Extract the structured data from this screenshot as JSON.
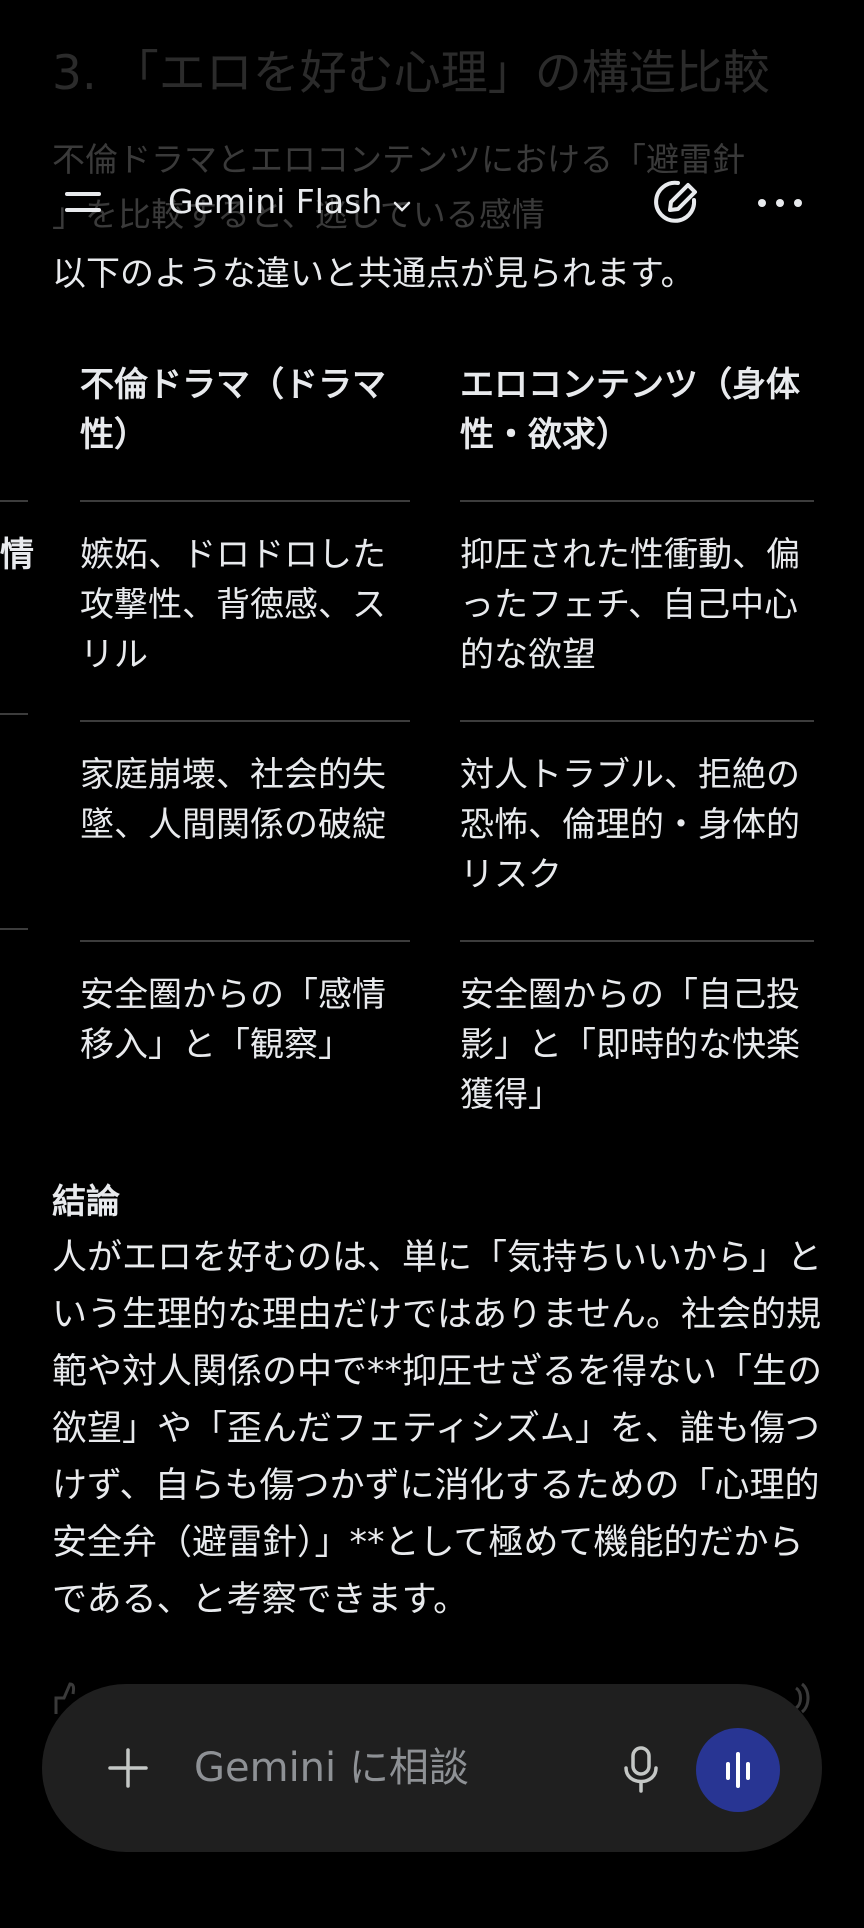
{
  "faded_header": {
    "title": "3. 「エロを好む心理」の構造比較",
    "line1": "不倫ドラマとエロコンテンツにおける「避雷針",
    "line2": "」を比較すると、逃している感情"
  },
  "topbar": {
    "model_label": "Gemini Flash"
  },
  "intro_text": "以下のような違いと共通点が見られます。",
  "table": {
    "headers": [
      "不倫ドラマ（ドラマ性）",
      "エロコンテンツ（身体性・欲求）"
    ],
    "rows": [
      [
        "嫉妬、ドロドロした攻撃性、背徳感、スリル",
        "抑圧された性衝動、偏ったフェチ、自己中心的な欲望"
      ],
      [
        "家庭崩壊、社会的失墜、人間関係の破綻",
        "対人トラブル、拒絶の恐怖、倫理的・身体的リスク"
      ],
      [
        "安全圏からの「感情移入」と「観察」",
        "安全圏からの「自己投影」と「即時的な快楽獲得」"
      ]
    ],
    "clipped_left_char": "情"
  },
  "conclusion": {
    "heading": "結論",
    "body": "人がエロを好むのは、単に「気持ちいいから」という生理的な理由だけではありません。社会的規範や対人関係の中で**抑圧せざるを得ない「生の欲望」や「歪んだフェティシズム」を、誰も傷つけず、自らも傷つかずに消化するための「心理的安全弁（避雷針）」**として極めて機能的だからである、と考察できます。"
  },
  "input": {
    "placeholder": "Gemini に相談"
  },
  "colors": {
    "background": "#000000",
    "text": "#e8eaed",
    "input_bg": "#1f1f1f",
    "voice_button": "#283593"
  }
}
